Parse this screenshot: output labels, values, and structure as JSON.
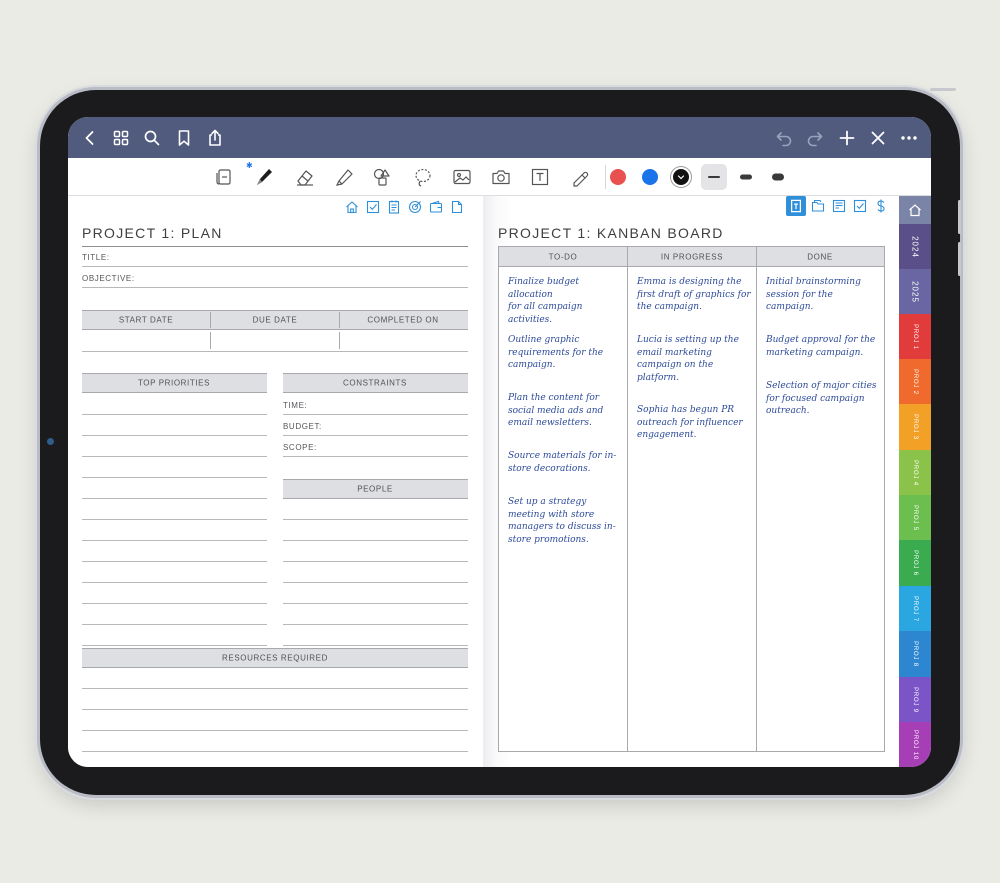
{
  "app": {
    "topbar_bg": "#505b7e",
    "topbar_left_icons": [
      "back-chevron-icon",
      "grid-icon",
      "search-icon",
      "bookmark-icon",
      "share-icon"
    ],
    "topbar_right_icons": [
      "undo-icon",
      "redo-icon",
      "plus-icon",
      "close-icon",
      "more-icon"
    ]
  },
  "toolbar": {
    "tools": [
      "read-mode-icon",
      "pen-icon",
      "eraser-icon",
      "highlighter-icon",
      "shapes-icon",
      "lasso-icon",
      "image-icon",
      "camera-icon",
      "text-icon",
      "elements-icon"
    ],
    "colors": [
      "#e8514f",
      "#1a73e8",
      "#111111"
    ],
    "stroke_widths": [
      "thin",
      "medium",
      "thick"
    ]
  },
  "left_page": {
    "title": "PROJECT 1: PLAN",
    "nav_icons": [
      "home-icon",
      "check-icon",
      "notes-icon",
      "target-icon",
      "wallet-icon",
      "document-icon"
    ],
    "fields": {
      "title": "TITLE:",
      "objective": "OBJECTIVE:"
    },
    "dates": {
      "start": "START DATE",
      "due": "DUE DATE",
      "completed": "COMPLETED ON"
    },
    "top_priorities": "TOP PRIORITIES",
    "constraints": {
      "header": "CONSTRAINTS",
      "time": "TIME:",
      "budget": "BUDGET:",
      "scope": "SCOPE:"
    },
    "people": "PEOPLE",
    "resources": "RESOURCES REQUIRED"
  },
  "right_page": {
    "title": "PROJECT 1: KANBAN BOARD",
    "nav_icons": [
      "kanban-icon",
      "files-icon",
      "planner-icon",
      "check-icon",
      "dollar-icon"
    ],
    "columns": [
      {
        "header": "TO-DO",
        "cards": [
          [
            "Finalize budget allocation",
            "for all campaign",
            "activities."
          ],
          [
            "Outline graphic",
            "requirements for the",
            "campaign."
          ],
          [
            "Plan the content for",
            "social media ads and",
            "email newsletters."
          ],
          [
            "Source materials for in-",
            "store decorations."
          ],
          [
            "Set up a strategy",
            "meeting with store",
            "managers to discuss in-",
            "store promotions."
          ]
        ]
      },
      {
        "header": "IN PROGRESS",
        "cards": [
          [
            "Emma is designing the",
            "first draft of graphics for",
            "the campaign."
          ],
          [
            "Lucia is setting up the",
            "email marketing",
            "campaign on the",
            "platform."
          ],
          [
            "Sophia has begun PR",
            "outreach for influencer",
            "engagement."
          ]
        ]
      },
      {
        "header": "DONE",
        "cards": [
          [
            "Initial brainstorming",
            "session for the",
            "campaign."
          ],
          [
            "Budget approval for the",
            "marketing campaign."
          ],
          [
            "Selection of major cities",
            "for focused campaign",
            "outreach."
          ]
        ]
      }
    ]
  },
  "side_tabs": [
    {
      "label": "",
      "icon": "home-icon",
      "color": "#7a84a6"
    },
    {
      "label": "2024",
      "color": "#5a4f88"
    },
    {
      "label": "2025",
      "color": "#6a66a3"
    },
    {
      "label": "PROJ 1",
      "color": "#e23b3b"
    },
    {
      "label": "PROJ 2",
      "color": "#ef6a2c"
    },
    {
      "label": "PROJ 3",
      "color": "#f2a126"
    },
    {
      "label": "PROJ 4",
      "color": "#8bc34a"
    },
    {
      "label": "PROJ 5",
      "color": "#6cbf4e"
    },
    {
      "label": "PROJ 6",
      "color": "#3bab4f"
    },
    {
      "label": "PROJ 7",
      "color": "#2aa7e0"
    },
    {
      "label": "PROJ 8",
      "color": "#2d86d0"
    },
    {
      "label": "PROJ 9",
      "color": "#7b55c7"
    },
    {
      "label": "PROJ 10",
      "color": "#a63fb5"
    }
  ]
}
